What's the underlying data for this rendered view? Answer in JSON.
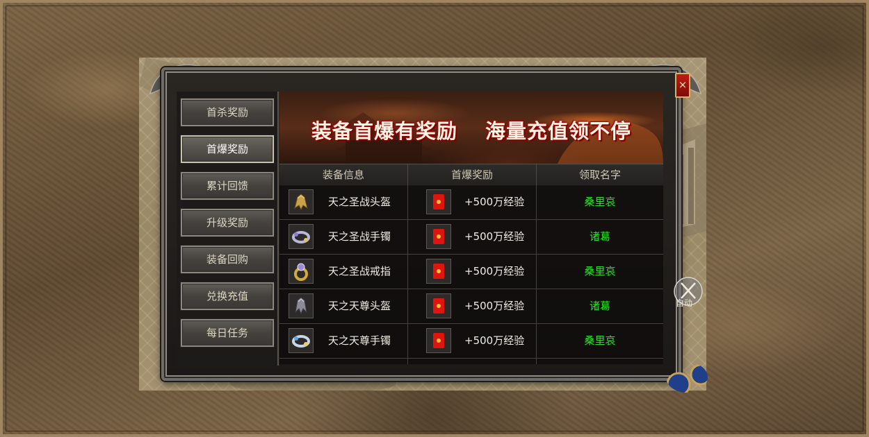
{
  "colors": {
    "name_green": "#22e51f",
    "banner_text": "#fff3e4",
    "close_red": "#c21b12"
  },
  "close_icon": "×",
  "sidebar": {
    "items": [
      {
        "label": "首杀奖励",
        "active": false
      },
      {
        "label": "首爆奖励",
        "active": true
      },
      {
        "label": "累计回馈",
        "active": false
      },
      {
        "label": "升级奖励",
        "active": false
      },
      {
        "label": "装备回购",
        "active": false
      },
      {
        "label": "兑换充值",
        "active": false
      },
      {
        "label": "每日任务",
        "active": false
      }
    ]
  },
  "banner": {
    "left": "装备首爆有奖励",
    "right": "海量充值领不停"
  },
  "table": {
    "headers": [
      "装备信息",
      "首爆奖励",
      "领取名字"
    ],
    "rows": [
      {
        "item": "天之圣战头盔",
        "item_icon": "helmet-icon",
        "reward": "+500万经验",
        "claimer": "桑里哀"
      },
      {
        "item": "天之圣战手镯",
        "item_icon": "bracelet-icon",
        "reward": "+500万经验",
        "claimer": "诸葛"
      },
      {
        "item": "天之圣战戒指",
        "item_icon": "ring-icon",
        "reward": "+500万经验",
        "claimer": "桑里哀"
      },
      {
        "item": "天之天尊头盔",
        "item_icon": "helmet-icon",
        "reward": "+500万经验",
        "claimer": "诸葛"
      },
      {
        "item": "天之天尊手镯",
        "item_icon": "bracelet-icon",
        "reward": "+500万经验",
        "claimer": "桑里哀"
      }
    ]
  },
  "auto_button": {
    "label": "自动",
    "icon": "crossed-swords-icon"
  }
}
